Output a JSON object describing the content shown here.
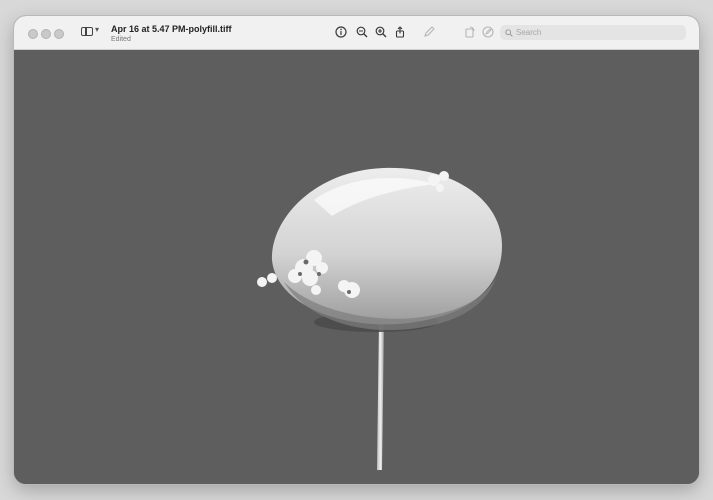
{
  "window": {
    "title": "Apr 16 at 5.47 PM-polyfill.tiff",
    "subtitle": "Edited"
  },
  "toolbar": {
    "icons": [
      "info-icon",
      "zoom-out-icon",
      "zoom-in-icon",
      "share-icon",
      "markup-icon",
      "rotate-icon",
      "annotate-icon"
    ],
    "search_placeholder": "Search"
  },
  "image": {
    "subject": "tree-shaped sculpture on a pole",
    "colors": {
      "background": "#5e5e5e",
      "canopy_light": "#f2f2f2",
      "canopy_dark": "#8a8a8a",
      "pole": "#d9d9d9"
    }
  }
}
